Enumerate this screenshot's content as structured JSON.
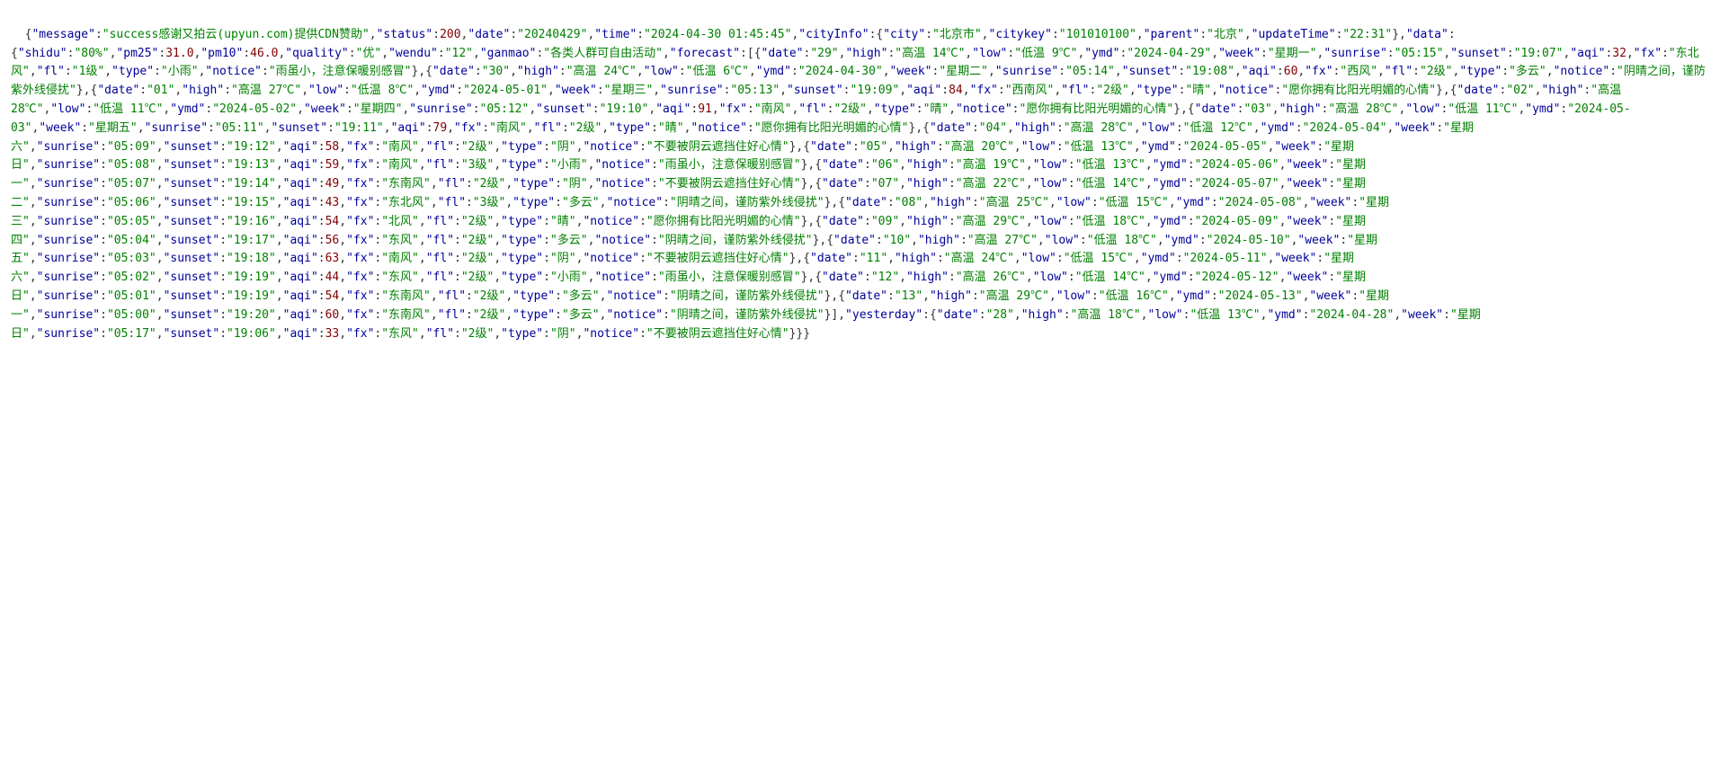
{
  "content": {
    "raw_text": "{\"message\":\"success感谢又拍云(upyun.com)提供CDN赞助\",\"status\":200,\"date\":\"20240429\",\"time\":\"2024-04-30 01:45:45\",\"cityInfo\":{\"city\":\"北京市\",\"citykey\":\"101010100\",\"parent\":\"北京\",\"updateTime\":\"22:31\"},\"data\":{\"shidu\":\"80%\",\"pm25\":31.0,\"pm10\":46.0,\"quality\":\"优\",\"wendu\":\"12\",\"ganmao\":\"各类人群可自由活动\",\"forecast\":[{\"date\":\"29\",\"high\":\"高温 14℃\",\"low\":\"低温 9℃\",\"ymd\":\"2024-04-29\",\"week\":\"星期一\",\"sunrise\":\"05:15\",\"sunset\":\"19:07\",\"aqi\":32,\"fx\":\"东北风\",\"fl\":\"1级\",\"type\":\"小雨\",\"notice\":\"雨虽小，注意保暖别感冒\"},{\"date\":\"30\",\"high\":\"高温 24℃\",\"low\":\"低温 6℃\",\"ymd\":\"2024-04-30\",\"week\":\"星期二\",\"sunrise\":\"05:14\",\"sunset\":\"19:08\",\"aqi\":60,\"fx\":\"西风\",\"fl\":\"2级\",\"type\":\"多云\",\"notice\":\"阴晴之间，谨防紫外线侵扰\"},{\"date\":\"01\",\"high\":\"高温 27℃\",\"low\":\"低温 8℃\",\"ymd\":\"2024-05-01\",\"week\":\"星期三\",\"sunrise\":\"05:13\",\"sunset\":\"19:09\",\"aqi\":84,\"fx\":\"西南风\",\"fl\":\"2级\",\"type\":\"晴\",\"notice\":\"愿你拥有比阳光明媚的心情\"},{\"date\":\"02\",\"high\":\"高温 28℃\",\"low\":\"低温 11℃\",\"ymd\":\"2024-05-02\",\"week\":\"星期四\",\"sunrise\":\"05:12\",\"sunset\":\"19:10\",\"aqi\":91,\"fx\":\"南风\",\"fl\":\"2级\",\"type\":\"晴\",\"notice\":\"愿你拥有比阳光明媚的心情\"},{\"date\":\"03\",\"high\":\"高温 28℃\",\"low\":\"低温 11℃\",\"ymd\":\"2024-05-03\",\"week\":\"星期五\",\"sunrise\":\"05:11\",\"sunset\":\"19:11\",\"aqi\":79,\"fx\":\"南风\",\"fl\":\"2级\",\"type\":\"晴\",\"notice\":\"愿你拥有比阳光明媚的心情\"},{\"date\":\"04\",\"high\":\"高温 28℃\",\"low\":\"低温 12℃\",\"ymd\":\"2024-05-04\",\"week\":\"星期六\",\"sunrise\":\"05:09\",\"sunset\":\"19:12\",\"aqi\":58,\"fx\":\"南风\",\"fl\":\"2级\",\"type\":\"阴\",\"notice\":\"不要被阴云遮挡住好心情\"},{\"date\":\"05\",\"high\":\"高温 20℃\",\"low\":\"低温 13℃\",\"ymd\":\"2024-05-05\",\"week\":\"星期日\",\"sunrise\":\"05:08\",\"sunset\":\"19:13\",\"aqi\":59,\"fx\":\"南风\",\"fl\":\"3级\",\"type\":\"小雨\",\"notice\":\"雨虽小，注意保暖别感冒\"},{\"date\":\"06\",\"high\":\"高温 19℃\",\"low\":\"低温 13℃\",\"ymd\":\"2024-05-06\",\"week\":\"星期一\",\"sunrise\":\"05:07\",\"sunset\":\"19:14\",\"aqi\":49,\"fx\":\"东南风\",\"fl\":\"2级\",\"type\":\"阴\",\"notice\":\"不要被阴云遮挡住好心情\"},{\"date\":\"07\",\"high\":\"高温 22℃\",\"low\":\"低温 14℃\",\"ymd\":\"2024-05-07\",\"week\":\"星期二\",\"sunrise\":\"05:06\",\"sunset\":\"19:15\",\"aqi\":43,\"fx\":\"东北风\",\"fl\":\"3级\",\"type\":\"多云\",\"notice\":\"阴晴之间，谨防紫外线侵扰\"},{\"date\":\"08\",\"high\":\"高温 25℃\",\"low\":\"低温 15℃\",\"ymd\":\"2024-05-08\",\"week\":\"星期三\",\"sunrise\":\"05:05\",\"sunset\":\"19:16\",\"aqi\":54,\"fx\":\"北风\",\"fl\":\"2级\",\"type\":\"晴\",\"notice\":\"愿你拥有比阳光明媚的心情\"},{\"date\":\"09\",\"high\":\"高温 29℃\",\"low\":\"低温 18℃\",\"ymd\":\"2024-05-09\",\"week\":\"星期四\",\"sunrise\":\"05:04\",\"sunset\":\"19:17\",\"aqi\":56,\"fx\":\"东风\",\"fl\":\"2级\",\"type\":\"多云\",\"notice\":\"阴晴之间，谨防紫外线侵扰\"},{\"date\":\"10\",\"high\":\"高温 27℃\",\"low\":\"低温 18℃\",\"ymd\":\"2024-05-10\",\"week\":\"星期五\",\"sunrise\":\"05:03\",\"sunset\":\"19:18\",\"aqi\":63,\"fx\":\"南风\",\"fl\":\"2级\",\"type\":\"阴\",\"notice\":\"不要被阴云遮挡住好心情\"},{\"date\":\"11\",\"high\":\"高温 24℃\",\"low\":\"低温 15℃\",\"ymd\":\"2024-05-11\",\"week\":\"星期六\",\"sunrise\":\"05:02\",\"sunset\":\"19:19\",\"aqi\":44,\"fx\":\"东风\",\"fl\":\"2级\",\"type\":\"小雨\",\"notice\":\"雨虽小，注意保暖别感冒\"},{\"date\":\"12\",\"high\":\"高温 26℃\",\"low\":\"低温 14℃\",\"ymd\":\"2024-05-12\",\"week\":\"星期日\",\"sunrise\":\"05:01\",\"sunset\":\"19:19\",\"aqi\":54,\"fx\":\"东南风\",\"fl\":\"2级\",\"type\":\"多云\",\"notice\":\"阴晴之间，谨防紫外线侵扰\"},{\"date\":\"13\",\"high\":\"高温 29℃\",\"low\":\"低温 16℃\",\"ymd\":\"2024-05-13\",\"week\":\"星期一\",\"sunrise\":\"05:00\",\"sunset\":\"19:20\",\"aqi\":60,\"fx\":\"东南风\",\"fl\":\"2级\",\"type\":\"多云\",\"notice\":\"阴晴之间，谨防紫外线侵扰\"}],\"yesterday\":{\"date\":\"28\",\"high\":\"高温 18℃\",\"low\":\"低温 13℃\",\"ymd\":\"2024-04-28\",\"week\":\"星期日\",\"sunrise\":\"05:17\",\"sunset\":\"19:06\",\"aqi\":33,\"fx\":\"东风\",\"fl\":\"2级\",\"type\":\"阴\",\"notice\":\"不要被阴云遮挡住好心情\"}}}"
  }
}
